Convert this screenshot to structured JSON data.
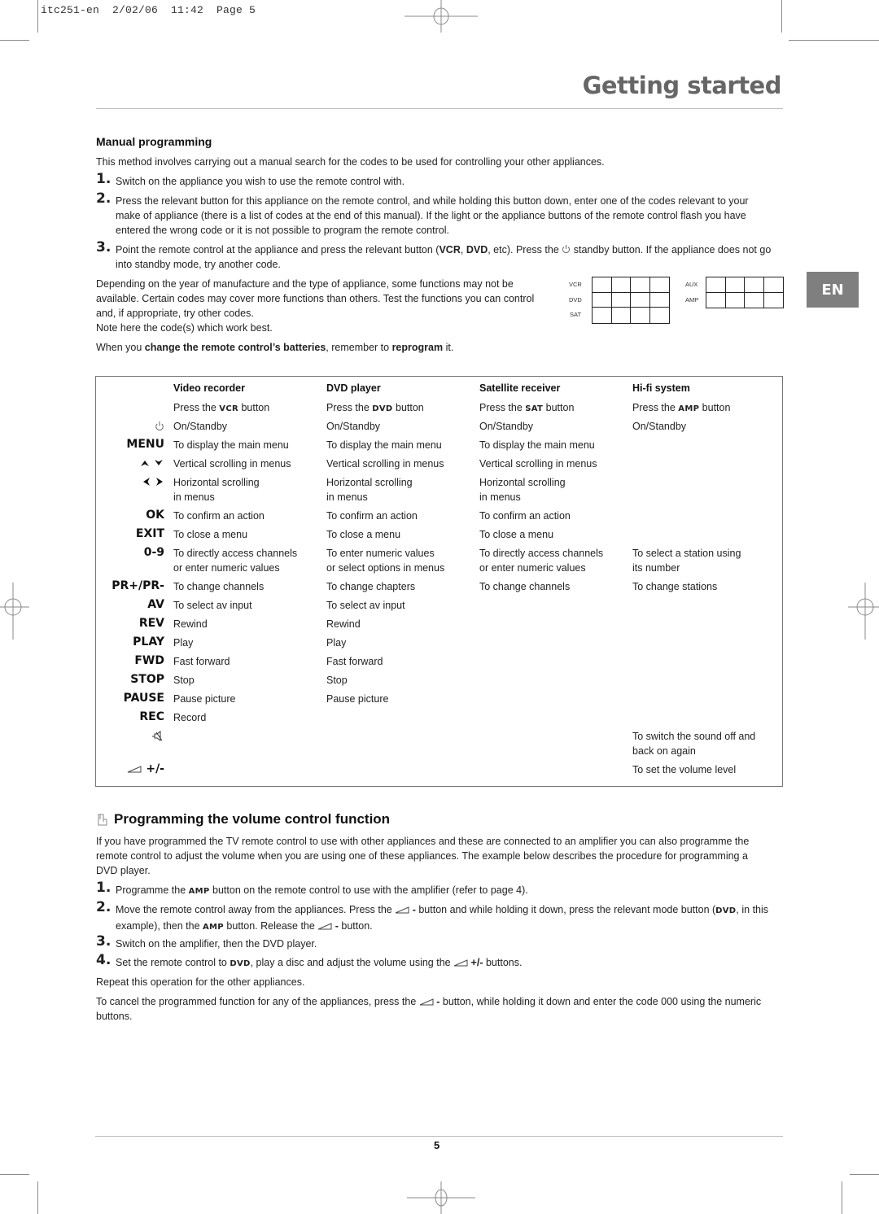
{
  "slug": "itc251-en  2/02/06  11:42  Page 5",
  "header": {
    "title": "Getting started"
  },
  "language_badge": "EN",
  "manual_programming": {
    "heading": "Manual programming",
    "intro": "This method involves carrying out a manual search for the codes to be used for controlling your other appliances.",
    "steps": [
      {
        "num": "1.",
        "text": "Switch on the appliance you wish to use the remote control with."
      },
      {
        "num": "2.",
        "text": "Press the relevant button for this appliance on the remote control, and while holding this button down, enter one of the codes relevant to your make of appliance (there is a list of codes at the end of this manual). If the light or the appliance buttons of the remote control flash you have entered the wrong code or it is not possible to program the remote control."
      },
      {
        "num": "3.",
        "text_a": "Point the remote control at the appliance and press the relevant button (",
        "bold_1": "VCR",
        "sep": ", ",
        "bold_2": "DVD",
        "text_b": ", etc). Press the ",
        "text_c": " standby button. If the appliance does not go into standby mode, try another code."
      }
    ],
    "depending": "Depending on the year of manufacture and the type of appliance, some functions may not be available. Certain codes may cover more functions than others. Test the functions you can control and, if appropriate, try other codes.",
    "note": "Note here the code(s) which work best.",
    "battery_a": "When you ",
    "battery_b1": "change the remote control’s batteries",
    "battery_c": ", remember to ",
    "battery_b2": "reprogram",
    "battery_d": " it."
  },
  "code_boxes": {
    "left_labels": [
      "VCR",
      "DVD",
      "SAT"
    ],
    "right_labels": [
      "AUX",
      "AMP"
    ]
  },
  "function_table": {
    "columns": [
      "Video recorder",
      "DVD player",
      "Satellite receiver",
      "Hi-fi system"
    ],
    "press_row": [
      {
        "a": "Press the ",
        "k": "VCR",
        "b": " button"
      },
      {
        "a": "Press the ",
        "k": "DVD",
        "b": " button"
      },
      {
        "a": "Press the ",
        "k": "SAT",
        "b": " button"
      },
      {
        "a": "Press the ",
        "k": "AMP",
        "b": " button"
      }
    ],
    "rows": [
      {
        "key": "standby",
        "icon": "power-icon",
        "cells": [
          "On/Standby",
          "On/Standby",
          "On/Standby",
          "On/Standby"
        ]
      },
      {
        "key": "MENU",
        "cells": [
          "To display the main menu",
          "To display the main menu",
          "To display the main menu",
          ""
        ]
      },
      {
        "key": "up-down",
        "icon": "up-down-arrows-icon",
        "cells": [
          "Vertical scrolling in menus",
          "Vertical scrolling in menus",
          "Vertical scrolling in menus",
          ""
        ]
      },
      {
        "key": "left-right",
        "icon": "left-right-arrows-icon",
        "cells": [
          "Horizontal scrolling\nin menus",
          "Horizontal scrolling\nin menus",
          "Horizontal scrolling\nin menus",
          ""
        ]
      },
      {
        "key": "OK",
        "cells": [
          "To confirm an action",
          "To confirm an action",
          "To confirm an action",
          ""
        ]
      },
      {
        "key": "EXIT",
        "cells": [
          "To close a menu",
          "To close a menu",
          "To close a menu",
          ""
        ]
      },
      {
        "key": "0-9",
        "cells": [
          "To directly access channels\nor enter numeric values",
          "To enter numeric values\nor select options in menus",
          "To directly access channels\nor enter numeric values",
          "To select a station using\nits number"
        ]
      },
      {
        "key": "PR+/PR-",
        "cells": [
          "To change channels",
          "To change chapters",
          "To change channels",
          "To change stations"
        ]
      },
      {
        "key": "AV",
        "cells": [
          "To select av input",
          "To select av input",
          "",
          ""
        ]
      },
      {
        "key": "REV",
        "cells": [
          "Rewind",
          "Rewind",
          "",
          ""
        ]
      },
      {
        "key": "PLAY",
        "cells": [
          "Play",
          "Play",
          "",
          ""
        ]
      },
      {
        "key": "FWD",
        "cells": [
          "Fast forward",
          "Fast forward",
          "",
          ""
        ]
      },
      {
        "key": "STOP",
        "cells": [
          "Stop",
          "Stop",
          "",
          ""
        ]
      },
      {
        "key": "PAUSE",
        "cells": [
          "Pause picture",
          "Pause picture",
          "",
          ""
        ]
      },
      {
        "key": "REC",
        "cells": [
          "Record",
          "",
          "",
          ""
        ]
      },
      {
        "key": "mute",
        "icon": "mute-icon",
        "cells": [
          "",
          "",
          "",
          "To switch the sound off and\nback on again"
        ]
      },
      {
        "key": "+/-",
        "icon": "volume-icon",
        "cells": [
          "",
          "",
          "",
          "To set the volume level"
        ]
      }
    ]
  },
  "volume_section": {
    "heading": "Programming the volume control function",
    "intro": "If you have programmed the TV remote control to use with other appliances and these are connected to an amplifier you can also programme the remote control to adjust the volume when you are using one of these appliances. The example below describes the procedure for programming a DVD player.",
    "step1": {
      "num": "1.",
      "a": "Programme the ",
      "k": "AMP",
      "b": " button on the remote control to use with the amplifier (refer to page 4)."
    },
    "step2": {
      "num": "2.",
      "a": "Move the remote control away from the appliances. Press the ",
      "m1": " - ",
      "b": "button and while holding it down, press the relevant mode button (",
      "k1": "DVD",
      "c": ", in this example), then the ",
      "k2": "AMP",
      "d": " button. Release the ",
      "m2": " - ",
      "e": "button."
    },
    "step3": {
      "num": "3.",
      "text": "Switch on the amplifier, then the DVD player."
    },
    "step4": {
      "num": "4.",
      "a": "Set the remote control to ",
      "k": "DVD",
      "b": ", play a disc and adjust the volume using the ",
      "m": " +/- ",
      "c": "buttons."
    },
    "repeat": "Repeat this operation for the other appliances.",
    "cancel_a": "To cancel the programmed function for any of the appliances, press the ",
    "cancel_m": " - ",
    "cancel_b": "button, while holding it down and enter the code 000 using the numeric buttons."
  },
  "footer": {
    "page_number": "5"
  }
}
